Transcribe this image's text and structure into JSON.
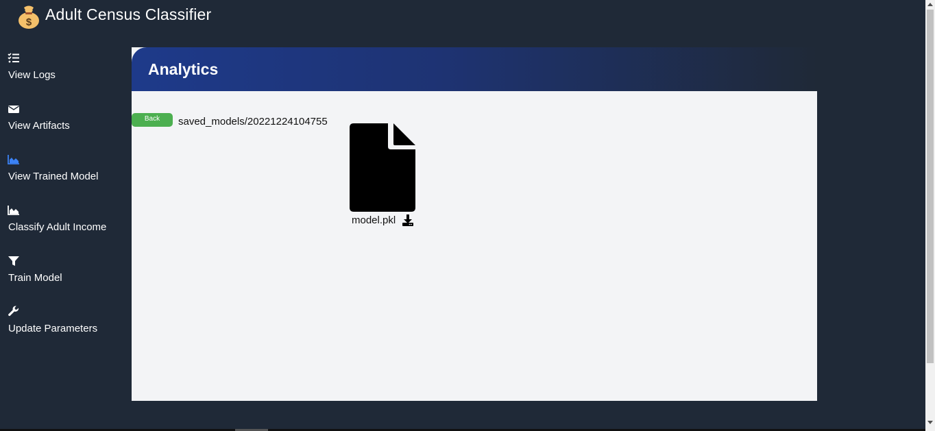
{
  "app": {
    "title": "Adult Census Classifier",
    "logo_icon": "money-bag-icon"
  },
  "sidebar": {
    "items": [
      {
        "label": "View Logs",
        "icon": "list-check-icon",
        "icon_color": "#ffffff"
      },
      {
        "label": "View Artifacts",
        "icon": "envelope-icon",
        "icon_color": "#ffffff"
      },
      {
        "label": "View Trained Model",
        "icon": "area-chart-icon",
        "icon_color": "#3b82f6"
      },
      {
        "label": "Classify Adult Income",
        "icon": "area-chart-icon",
        "icon_color": "#ffffff"
      },
      {
        "label": "Train Model",
        "icon": "filter-icon",
        "icon_color": "#ffffff"
      },
      {
        "label": "Update Parameters",
        "icon": "wrench-icon",
        "icon_color": "#ffffff"
      }
    ]
  },
  "main": {
    "header_title": "Analytics",
    "back_label": "Back",
    "path": "saved_models/20221224104755",
    "files": [
      {
        "name": "model.pkl",
        "icon": "file-icon",
        "action_icon": "download-icon"
      }
    ]
  },
  "colors": {
    "background": "#1f2937",
    "header_accent": "#1e3a8a",
    "content_bg": "#f3f4f6",
    "back_button": "#4caf50",
    "active_icon": "#3b82f6"
  }
}
